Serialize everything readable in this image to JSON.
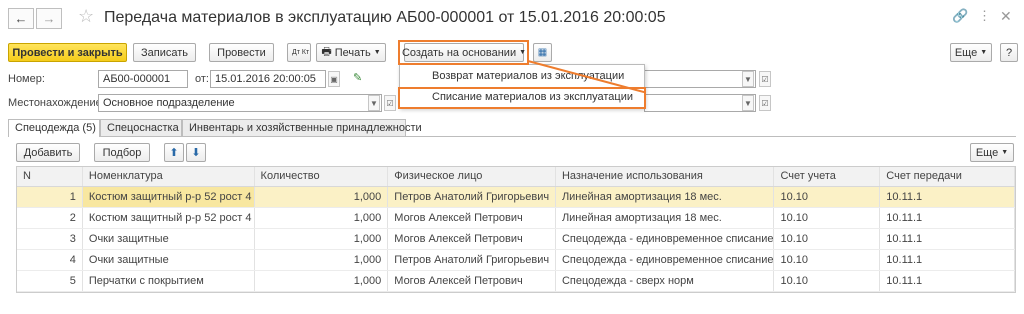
{
  "window": {
    "title": "Передача материалов в эксплуатацию АБ00-000001 от 15.01.2016 20:00:05"
  },
  "icons": {
    "back": "arrow-left-icon",
    "forward": "arrow-right-icon",
    "favorite": "star-icon",
    "link": "link-icon",
    "more": "more-icon",
    "close": "close-icon"
  },
  "toolbar": {
    "post_close": "Провести и закрыть",
    "save": "Записать",
    "post": "Провести",
    "dt_kt": "Дт Кт",
    "print": "Печать",
    "create_based": "Создать на основании",
    "more": "Еще",
    "help": "?"
  },
  "dropdown": {
    "items": [
      "Возврат материалов из эксплуатации",
      "Списание материалов из эксплуатации"
    ]
  },
  "form": {
    "number_label": "Номер:",
    "number_value": "АБ00-000001",
    "date_label": "от:",
    "date_value": "15.01.2016 20:00:05",
    "location_label": "Местонахождение:",
    "location_value": "Основное подразделение"
  },
  "tabs": [
    "Спецодежда (5)",
    "Спецоснастка",
    "Инвентарь и хозяйственные принадлежности"
  ],
  "table_toolbar": {
    "add": "Добавить",
    "pick": "Подбор",
    "more": "Еще"
  },
  "table": {
    "columns": [
      "N",
      "Номенклатура",
      "Количество",
      "Физическое лицо",
      "Назначение использования",
      "Счет учета",
      "Счет передачи"
    ],
    "rows": [
      [
        "1",
        "Костюм защитный р-р 52 рост 4",
        "1,000",
        "Петров Анатолий Григорьевич",
        "Линейная амортизация 18 мес.",
        "10.10",
        "10.11.1"
      ],
      [
        "2",
        "Костюм защитный р-р 52 рост 4",
        "1,000",
        "Могов Алексей Петрович",
        "Линейная амортизация 18 мес.",
        "10.10",
        "10.11.1"
      ],
      [
        "3",
        "Очки защитные",
        "1,000",
        "Могов Алексей Петрович",
        "Спецодежда - единовременное списание",
        "10.10",
        "10.11.1"
      ],
      [
        "4",
        "Очки защитные",
        "1,000",
        "Петров Анатолий Григорьевич",
        "Спецодежда - единовременное списание",
        "10.10",
        "10.11.1"
      ],
      [
        "5",
        "Перчатки с покрытием",
        "1,000",
        "Могов Алексей Петрович",
        "Спецодежда - сверх норм",
        "10.10",
        "10.11.1"
      ]
    ]
  },
  "colors": {
    "primary_button": "#f5cc1a",
    "highlight": "#ee7d2e",
    "selected_row": "#fbf1c6"
  }
}
